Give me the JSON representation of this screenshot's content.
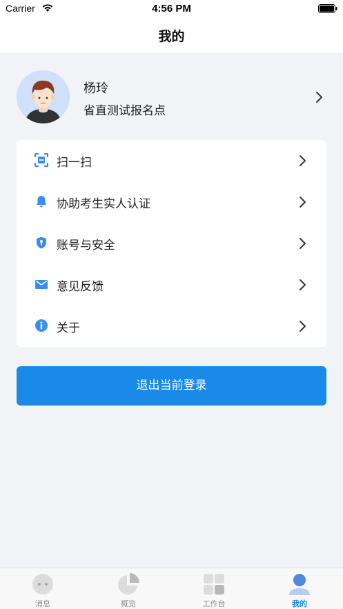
{
  "status_bar": {
    "carrier": "Carrier",
    "time": "4:56 PM"
  },
  "nav": {
    "title": "我的"
  },
  "profile": {
    "name": "杨玲",
    "org": "省直测试报名点"
  },
  "menu": {
    "items": [
      {
        "label": "扫一扫",
        "icon": "scan-icon"
      },
      {
        "label": "协助考生实人认证",
        "icon": "bell-icon"
      },
      {
        "label": "账号与安全",
        "icon": "shield-icon"
      },
      {
        "label": "意见反馈",
        "icon": "mail-icon"
      },
      {
        "label": "关于",
        "icon": "info-icon"
      }
    ]
  },
  "logout": {
    "label": "退出当前登录"
  },
  "tabs": [
    {
      "label": "消息",
      "icon": "chat-icon",
      "active": false
    },
    {
      "label": "概览",
      "icon": "pie-chart-icon",
      "active": false
    },
    {
      "label": "工作台",
      "icon": "grid-icon",
      "active": false
    },
    {
      "label": "我的",
      "icon": "person-icon",
      "active": true
    }
  ],
  "colors": {
    "accent": "#1a8ae8",
    "background": "#f2f3f7",
    "inactive_tab": "#8a8a8a"
  }
}
